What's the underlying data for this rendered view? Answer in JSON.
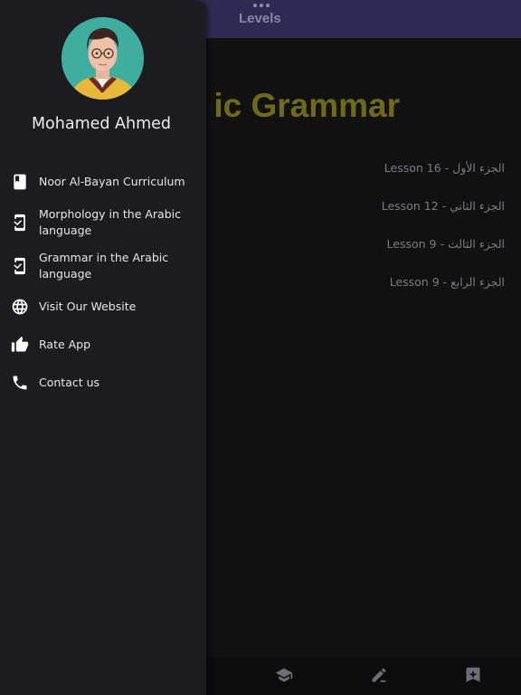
{
  "header": {
    "title": "Levels"
  },
  "main": {
    "title": "ic Grammar",
    "lessons": [
      {
        "label": "الجزء الأول - Lesson 16"
      },
      {
        "label": "الجزء الثاني - Lesson 12"
      },
      {
        "label": "الجزء الثالث - Lesson 9"
      },
      {
        "label": "الجزء الرابع - Lesson 9"
      }
    ]
  },
  "drawer": {
    "user_name": "Mohamed Ahmed",
    "items": [
      {
        "label": "Noor Al-Bayan Curriculum",
        "icon": "book-icon"
      },
      {
        "label": "Morphology in the Arabic language",
        "icon": "phone-link-icon"
      },
      {
        "label": "Grammar in the Arabic language",
        "icon": "phone-link-icon"
      },
      {
        "label": "Visit Our Website",
        "icon": "globe-icon"
      },
      {
        "label": "Rate App",
        "icon": "thumbs-up-icon"
      },
      {
        "label": "Contact us",
        "icon": "phone-icon"
      }
    ]
  },
  "bottom_nav": {
    "icons": [
      "graduation-cap-icon",
      "edit-note-icon",
      "bookmark-icon"
    ]
  },
  "colors": {
    "drawer_bg": "#1b1b20",
    "topbar_bg": "#2e2a52",
    "title_accent": "#6f6a1a",
    "background": "#111112"
  }
}
